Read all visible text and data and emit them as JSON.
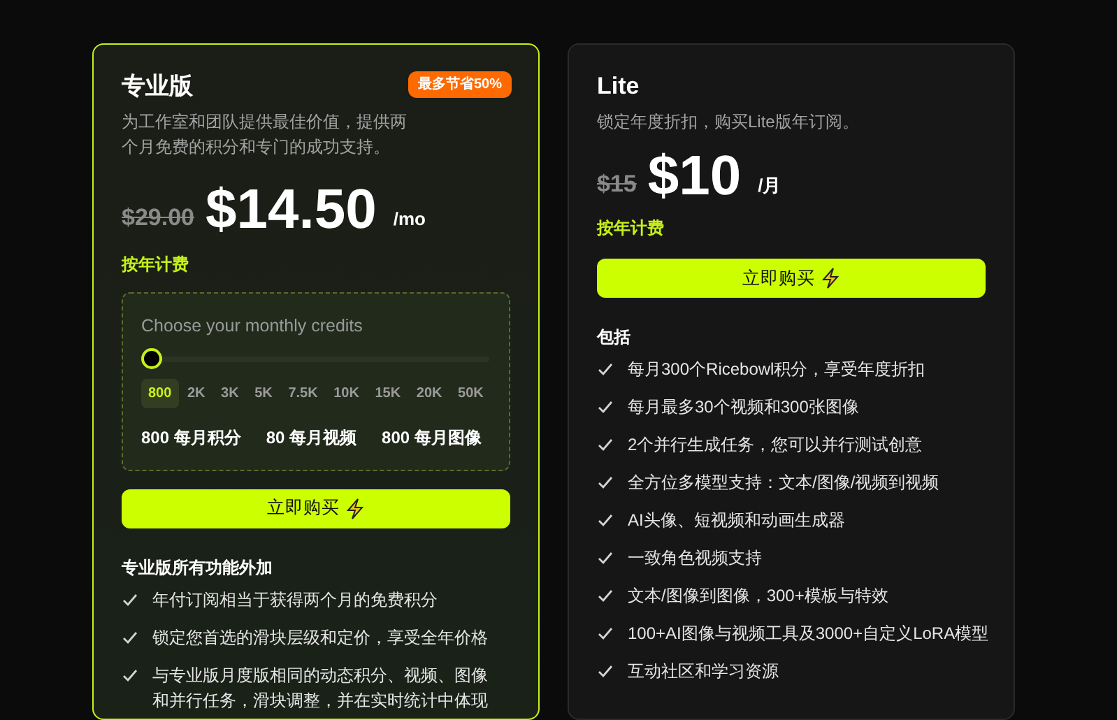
{
  "plans": [
    {
      "kind": "pro",
      "highlighted": true,
      "title": "专业版",
      "badge": "最多节省50%",
      "description": "为工作室和团队提供最佳价值，提供两个月免费的积分和专门的成功支持。",
      "old_price": "$29.00",
      "price": "$14.50",
      "period": "/mo",
      "billing": "按年计费",
      "credits": {
        "label": "Choose your monthly credits",
        "level": 0,
        "ticks": [
          {
            "label": "800",
            "selected": true
          },
          {
            "label": "2K",
            "selected": false
          },
          {
            "label": "3K",
            "selected": false
          },
          {
            "label": "5K",
            "selected": false
          },
          {
            "label": "7.5K",
            "selected": false
          },
          {
            "label": "10K",
            "selected": false
          },
          {
            "label": "15K",
            "selected": false
          },
          {
            "label": "20K",
            "selected": false
          },
          {
            "label": "50K",
            "selected": false
          }
        ],
        "stats": [
          "800 每月积分",
          "80 每月视频",
          "800 每月图像"
        ]
      },
      "button": "立即购买",
      "features_title": "专业版所有功能外加",
      "features": [
        "年付订阅相当于获得两个月的免费积分",
        "锁定您首选的滑块层级和定价，享受全年价格",
        "与专业版月度版相同的动态积分、视频、图像和并行任务，滑块调整，并在实时统计中体现"
      ]
    },
    {
      "kind": "lite",
      "highlighted": false,
      "title": "Lite",
      "description": "锁定年度折扣，购买Lite版年订阅。",
      "old_price": "$15",
      "price": "$10",
      "period": "/月",
      "billing": "按年计费",
      "button": "立即购买",
      "features_title": "包括",
      "features": [
        "每月300个Ricebowl积分，享受年度折扣",
        "每月最多30个视频和300张图像",
        "2个并行生成任务，您可以并行测试创意",
        "全方位多模型支持：文本/图像/视频到视频",
        "AI头像、短视频和动画生成器",
        "一致角色视频支持",
        "文本/图像到图像，300+模板与特效",
        "100+AI图像与视频工具及3000+自定义LoRA模型",
        "互动社区和学习资源"
      ]
    }
  ]
}
